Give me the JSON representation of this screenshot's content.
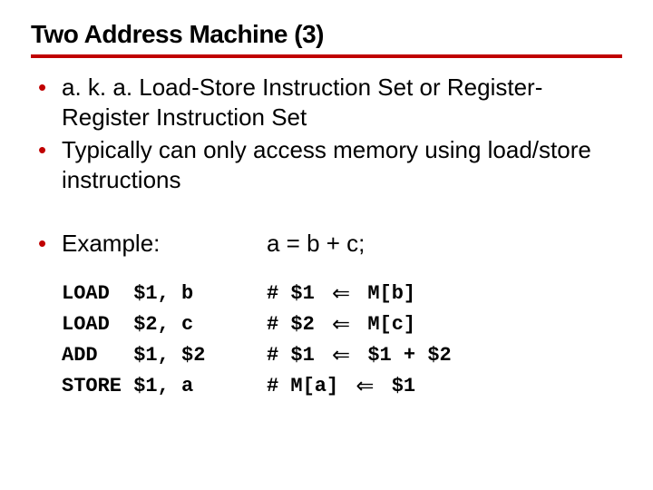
{
  "title": "Two Address Machine (3)",
  "bullets": [
    "a. k. a. Load-Store Instruction Set or Register-Register Instruction Set",
    "Typically can only access memory using load/store instructions"
  ],
  "example": {
    "label": "Example:",
    "expr": "a = b + c;"
  },
  "code": {
    "rows": [
      {
        "op": "LOAD",
        "args": "$1, b",
        "c_pre": "# $1 ",
        "c_post": " M[b]"
      },
      {
        "op": "LOAD",
        "args": "$2, c",
        "c_pre": "# $2 ",
        "c_post": " M[c]"
      },
      {
        "op": "ADD",
        "args": "$1, $2",
        "c_pre": "# $1 ",
        "c_post": " $1 + $2"
      },
      {
        "op": "STORE",
        "args": "$1, a",
        "c_pre": "# M[a] ",
        "c_post": " $1"
      }
    ]
  },
  "arrow_glyph": "⇐"
}
